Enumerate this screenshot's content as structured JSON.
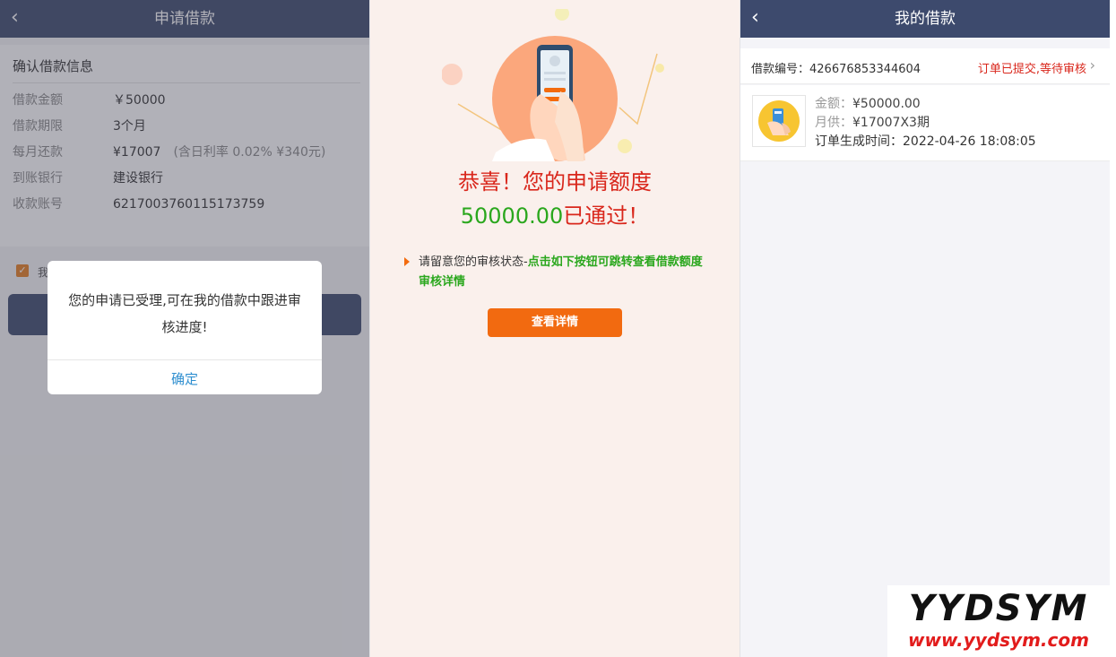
{
  "panel1": {
    "nav": {
      "back_icon": "‹",
      "title": "申请借款"
    },
    "section_title": "确认借款信息",
    "rows": [
      {
        "label": "借款金额",
        "value": "￥50000",
        "note": ""
      },
      {
        "label": "借款期限",
        "value": "3个月",
        "note": ""
      },
      {
        "label": "每月还款",
        "value": "¥17007",
        "note": "(含日利率 0.02% ¥340元)"
      },
      {
        "label": "到账银行",
        "value": "建设银行",
        "note": ""
      },
      {
        "label": "收款账号",
        "value": "6217003760115173759",
        "note": ""
      }
    ],
    "agree_text": "我",
    "checkbox_mark": "✓",
    "dialog": {
      "message": "您的申请已受理,可在我的借款中跟进审核进度!",
      "ok_label": "确定"
    }
  },
  "panel2": {
    "congrats": "恭喜！您的申请额度",
    "amount": "50000.00",
    "passed": "已通过！",
    "tip_prefix": "请留意您的审核状态-",
    "tip_highlight": "点击如下按钮可跳转查看借款额度审核详情",
    "button_label": "查看详情"
  },
  "panel3": {
    "nav": {
      "back_icon": "‹",
      "title": "我的借款"
    },
    "order_no_label": "借款编号：",
    "order_no": "426676853344604",
    "status": "订单已提交,等待审核",
    "chevron": "›",
    "amount_label": "金额：",
    "amount_value": "¥50000.00",
    "monthly_label": "月供：",
    "monthly_value": "¥17007X3期",
    "created_label": "订单生成时间：",
    "created_value": "2022-04-26 18:08:05"
  },
  "watermark": {
    "brand": "YYDSYM",
    "url": "www.yydsym.com"
  },
  "colors": {
    "navbar": "#3d4a6d",
    "accent_red": "#d9271c",
    "accent_green": "#2aa71d",
    "button_orange": "#f26a10",
    "link_blue": "#2f8fd0"
  }
}
